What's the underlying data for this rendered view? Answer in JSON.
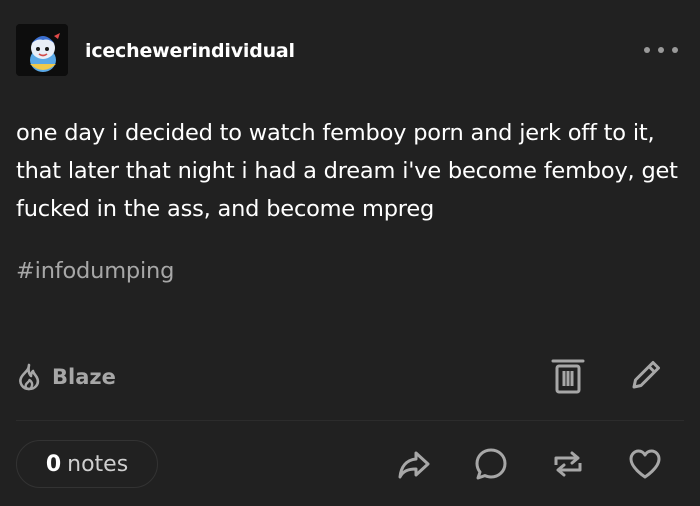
{
  "post": {
    "username": "icechewerindividual",
    "body": "one day i decided to watch femboy porn and jerk off to it, that later that night i had a dream i've become femboy, get fucked in the ass, and become mpreg",
    "tag": "#infodumping"
  },
  "actions": {
    "blaze_label": "Blaze",
    "notes_count": "0",
    "notes_label": "notes"
  },
  "colors": {
    "background": "#212121",
    "text": "#ffffff",
    "muted": "#a7a7a7",
    "icon": "#a7a7a7"
  },
  "icons": [
    "avatar",
    "more-icon",
    "blaze-flame-icon",
    "trash-icon",
    "pencil-icon",
    "share-icon",
    "reply-icon",
    "reblog-icon",
    "heart-icon"
  ]
}
